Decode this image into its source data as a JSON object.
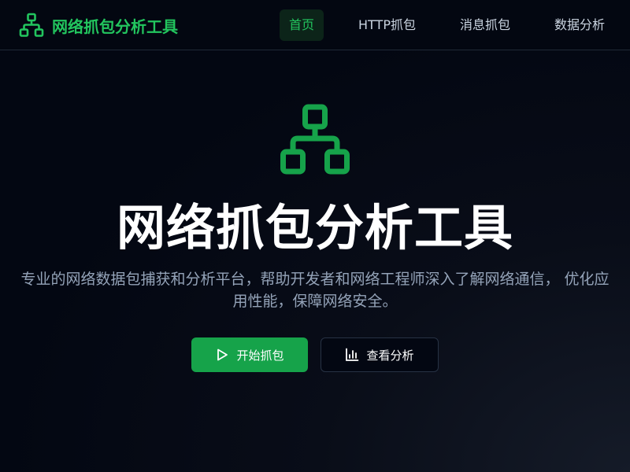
{
  "brand": {
    "icon": "network-icon",
    "title": "网络抓包分析工具",
    "accent_color": "#22c55e"
  },
  "nav": {
    "items": [
      {
        "label": "首页",
        "active": true
      },
      {
        "label": "HTTP抓包",
        "active": false
      },
      {
        "label": "消息抓包",
        "active": false
      },
      {
        "label": "数据分析",
        "active": false
      }
    ]
  },
  "hero": {
    "icon": "network-icon",
    "title": "网络抓包分析工具",
    "description": "专业的网络数据包捕获和分析平台，帮助开发者和网络工程师深入了解网络通信， 优化应用性能，保障网络安全。",
    "primary_button": {
      "label": "开始抓包",
      "icon": "play-icon",
      "color": "#16a34a"
    },
    "secondary_button": {
      "label": "查看分析",
      "icon": "bar-chart-icon"
    }
  }
}
